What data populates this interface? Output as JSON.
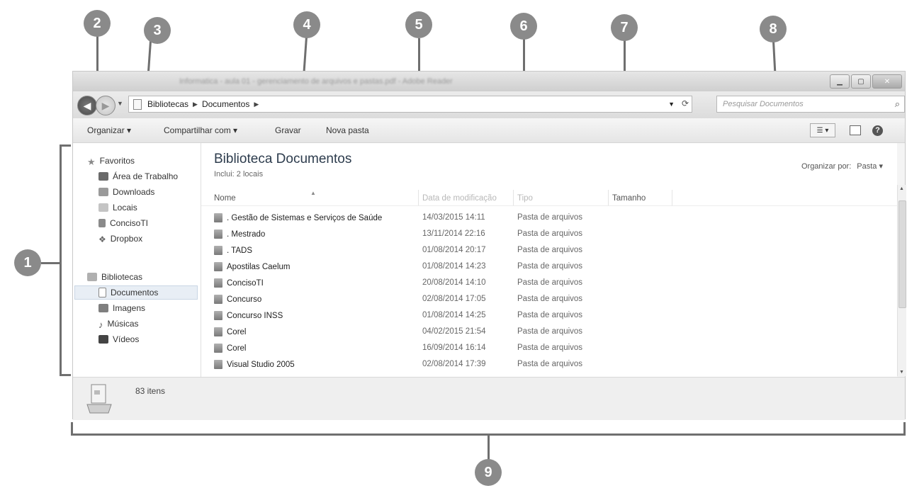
{
  "callouts": [
    "1",
    "2",
    "3",
    "4",
    "5",
    "6",
    "7",
    "8",
    "9"
  ],
  "window": {
    "blurred_title": "Informatica - aula 01 - gerenciamento de arquivos e pastas.pdf - Adobe Reader"
  },
  "address": {
    "crumbs": [
      "Bibliotecas",
      "Documentos"
    ],
    "search_placeholder": "Pesquisar Documentos"
  },
  "toolbar": {
    "organize": "Organizar ▾",
    "share": "Compartilhar com ▾",
    "burn": "Gravar",
    "new_folder": "Nova pasta"
  },
  "nav": {
    "favorites_header": "Favoritos",
    "favorites": [
      "Área de Trabalho",
      "Downloads",
      "Locais",
      "ConcisoTI",
      "Dropbox"
    ],
    "libraries_header": "Bibliotecas",
    "libraries": [
      "Documentos",
      "Imagens",
      "Músicas",
      "Vídeos"
    ]
  },
  "content": {
    "title": "Biblioteca Documentos",
    "subtitle": "Inclui: 2 locais",
    "arrange_label": "Organizar por:",
    "arrange_value": "Pasta ▾",
    "columns": [
      "Nome",
      "Data de modificação",
      "Tipo",
      "Tamanho"
    ],
    "rows": [
      {
        "name": ". Gestão de Sistemas e Serviços de Saúde",
        "date": "14/03/2015 14:11",
        "type": "Pasta de arquivos"
      },
      {
        "name": ". Mestrado",
        "date": "13/11/2014 22:16",
        "type": "Pasta de arquivos"
      },
      {
        "name": ". TADS",
        "date": "01/08/2014 20:17",
        "type": "Pasta de arquivos"
      },
      {
        "name": "Apostilas Caelum",
        "date": "01/08/2014 14:23",
        "type": "Pasta de arquivos"
      },
      {
        "name": "ConcisoTI",
        "date": "20/08/2014 14:10",
        "type": "Pasta de arquivos"
      },
      {
        "name": "Concurso",
        "date": "02/08/2014 17:05",
        "type": "Pasta de arquivos"
      },
      {
        "name": "Concurso INSS",
        "date": "01/08/2014 14:25",
        "type": "Pasta de arquivos"
      },
      {
        "name": "Corel",
        "date": "04/02/2015 21:54",
        "type": "Pasta de arquivos"
      },
      {
        "name": "Corel",
        "date": "16/09/2014 16:14",
        "type": "Pasta de arquivos"
      },
      {
        "name": "Visual Studio 2005",
        "date": "02/08/2014 17:39",
        "type": "Pasta de arquivos"
      }
    ]
  },
  "status": {
    "count": "83 itens"
  },
  "icons": {
    "back": "back-arrow-icon",
    "forward": "forward-arrow-icon",
    "refresh": "refresh-icon",
    "search": "search-icon",
    "help": "help-icon"
  }
}
